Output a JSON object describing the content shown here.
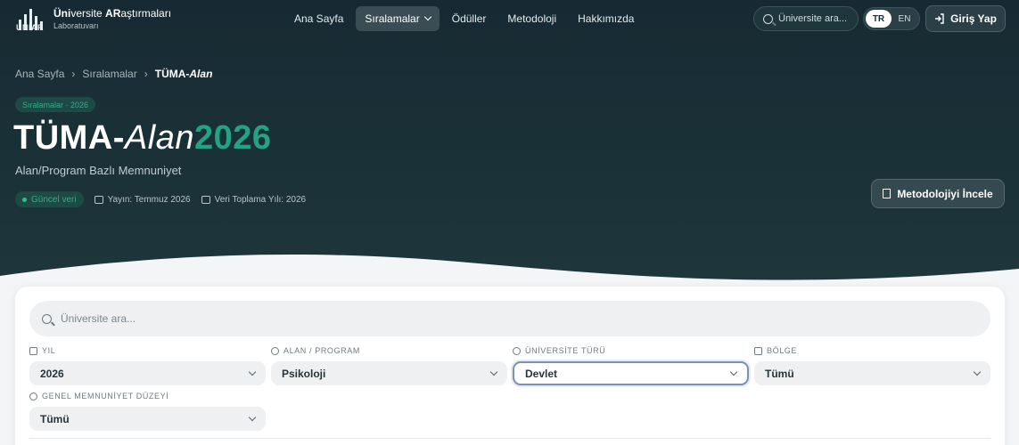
{
  "brand": {
    "logo_word": "UNIAR",
    "line1_bold1": "Üni",
    "line1_mid": "versite ",
    "line1_bold2": "AR",
    "line1_end": "aştırmaları",
    "line2": "Laboratuvarı"
  },
  "nav": {
    "items": [
      "Ana Sayfa",
      "Sıralamalar",
      "Ödüller",
      "Metodoloji",
      "Hakkımızda"
    ],
    "active_index": 1
  },
  "header": {
    "search_placeholder": "Üniversite ara...",
    "lang_tr": "TR",
    "lang_en": "EN",
    "active_lang": "TR",
    "login_label": "Giriş Yap"
  },
  "breadcrumb": {
    "home": "Ana Sayfa",
    "section": "Sıralamalar",
    "current_main": "TÜMA-",
    "current_italic": "Alan"
  },
  "hero": {
    "chip": "Sıralamalar · 2026",
    "title_main": "TÜMA-",
    "title_italic": "Alan",
    "title_year": "2026",
    "subtitle": "Alan/Program Bazlı Memnuniyet",
    "live_badge": "Güncel veri",
    "published": "Yayın: Temmuz 2026",
    "collection_year": "Veri Toplama Yılı: 2026",
    "method_button": "Metodolojiyi İncele"
  },
  "filters": {
    "search_placeholder": "Üniversite ara...",
    "year_label": "YIL",
    "year_value": "2026",
    "field_label": "ALAN / PROGRAM",
    "field_value": "Psikoloji",
    "type_label": "ÜNİVERSİTE TÜRÜ",
    "type_value": "Devlet",
    "region_label": "BÖLGE",
    "region_value": "Tümü",
    "satisfaction_label": "GENEL MEMNUNİYET DÜZEYİ",
    "satisfaction_value": "Tümü"
  },
  "colors": {
    "hero_bg": "#1a3037",
    "accent_green": "#23a384",
    "focus_border": "#7d8fb7"
  }
}
